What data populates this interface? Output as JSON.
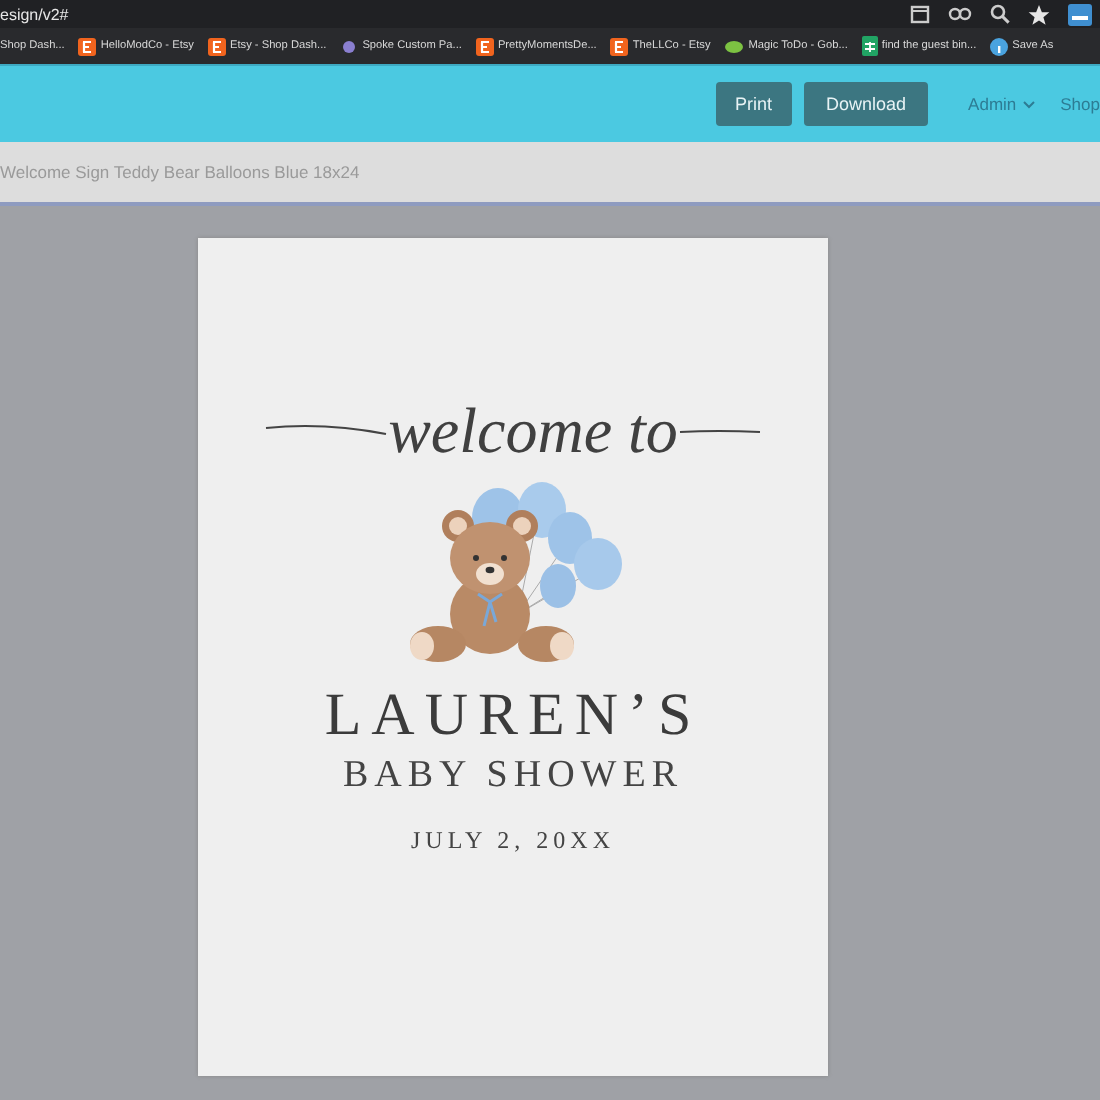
{
  "browser": {
    "url": "esign/v2#",
    "bookmarks": [
      {
        "kind": "plain",
        "label": "Shop Dash..."
      },
      {
        "kind": "etsy",
        "label": "HelloModCo - Etsy"
      },
      {
        "kind": "etsy",
        "label": "Etsy - Shop Dash..."
      },
      {
        "kind": "spoke",
        "label": "Spoke Custom Pa..."
      },
      {
        "kind": "etsy",
        "label": "PrettyMomentsDe..."
      },
      {
        "kind": "etsy",
        "label": "TheLLCo - Etsy"
      },
      {
        "kind": "magic",
        "label": "Magic ToDo - Gob..."
      },
      {
        "kind": "sheets",
        "label": "find the guest bin..."
      },
      {
        "kind": "info",
        "label": "Save As"
      }
    ]
  },
  "header": {
    "buttons": [
      "Print",
      "Download"
    ],
    "nav": [
      {
        "label": "Admin",
        "dropdown": true
      },
      {
        "label": "Shop",
        "dropdown": false
      }
    ]
  },
  "breadcrumb": "Welcome Sign Teddy Bear Balloons Blue 18x24",
  "sign": {
    "script": "welcome to",
    "name": "LAUREN’S",
    "event": "BABY SHOWER",
    "date": "JULY 2, 20XX"
  }
}
